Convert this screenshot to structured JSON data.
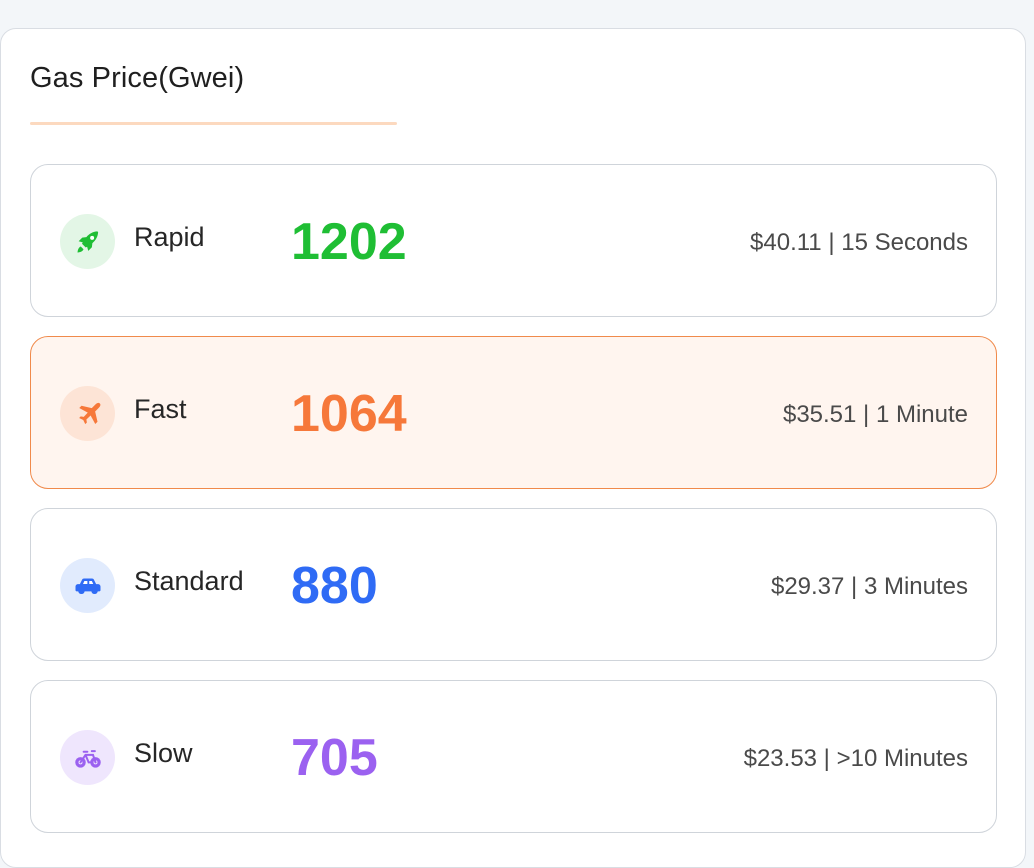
{
  "title": "Gas Price(Gwei)",
  "accent_underline_color": "#fcd9bf",
  "tiers": [
    {
      "label": "Rapid",
      "value": "1202",
      "meta": "$40.11 | 15 Seconds",
      "icon": "rocket-icon",
      "color": "#1fbe34",
      "icon_bg": "#e3f6e6",
      "selected": false
    },
    {
      "label": "Fast",
      "value": "1064",
      "meta": "$35.51 | 1 Minute",
      "icon": "airplane-icon",
      "color": "#f6783a",
      "icon_bg": "#fde4d6",
      "selected": true
    },
    {
      "label": "Standard",
      "value": "880",
      "meta": "$29.37 | 3 Minutes",
      "icon": "car-icon",
      "color": "#2f6bf5",
      "icon_bg": "#e1ebfd",
      "selected": false
    },
    {
      "label": "Slow",
      "value": "705",
      "meta": "$23.53 | >10 Minutes",
      "icon": "bicycle-icon",
      "color": "#9b61f0",
      "icon_bg": "#efe6fd",
      "selected": false
    }
  ]
}
